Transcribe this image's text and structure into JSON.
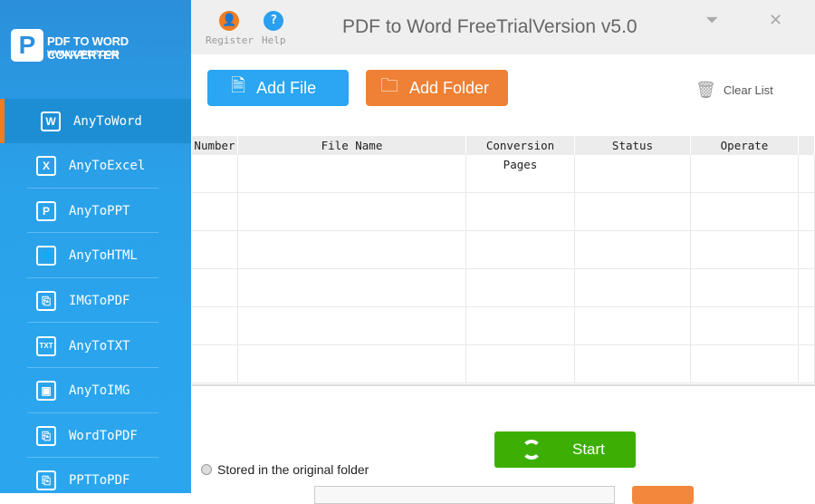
{
  "brand": {
    "title": "PDF TO WORD CONVERTER",
    "url": "WWW.XJPDF.COM"
  },
  "sidebar": {
    "items": [
      {
        "label": "AnyToWord",
        "icon": "W"
      },
      {
        "label": "AnyToExcel",
        "icon": "X"
      },
      {
        "label": "AnyToPPT",
        "icon": "P"
      },
      {
        "label": "AnyToHTML",
        "icon": "🌐"
      },
      {
        "label": "IMGToPDF",
        "icon": "⎘"
      },
      {
        "label": "AnyToTXT",
        "icon": "TXT"
      },
      {
        "label": "AnyToIMG",
        "icon": "▣"
      },
      {
        "label": "WordToPDF",
        "icon": "⎘"
      },
      {
        "label": "PPTToPDF",
        "icon": "⎘"
      }
    ]
  },
  "titlebar": {
    "register": "Register",
    "help": "Help",
    "title": "PDF to Word FreeTrialVersion v5.0"
  },
  "toolbar": {
    "add_file": "Add File",
    "add_folder": "Add Folder",
    "clear_list": "Clear List"
  },
  "table": {
    "headers": [
      "Number",
      "File Name",
      "Conversion Pages",
      "Status",
      "Operate"
    ]
  },
  "bottom": {
    "start": "Start",
    "stored_original": "Stored in the original folder"
  },
  "colors": {
    "accent": "#2aa2ea",
    "orange": "#f07d22",
    "green": "#3daf04"
  }
}
